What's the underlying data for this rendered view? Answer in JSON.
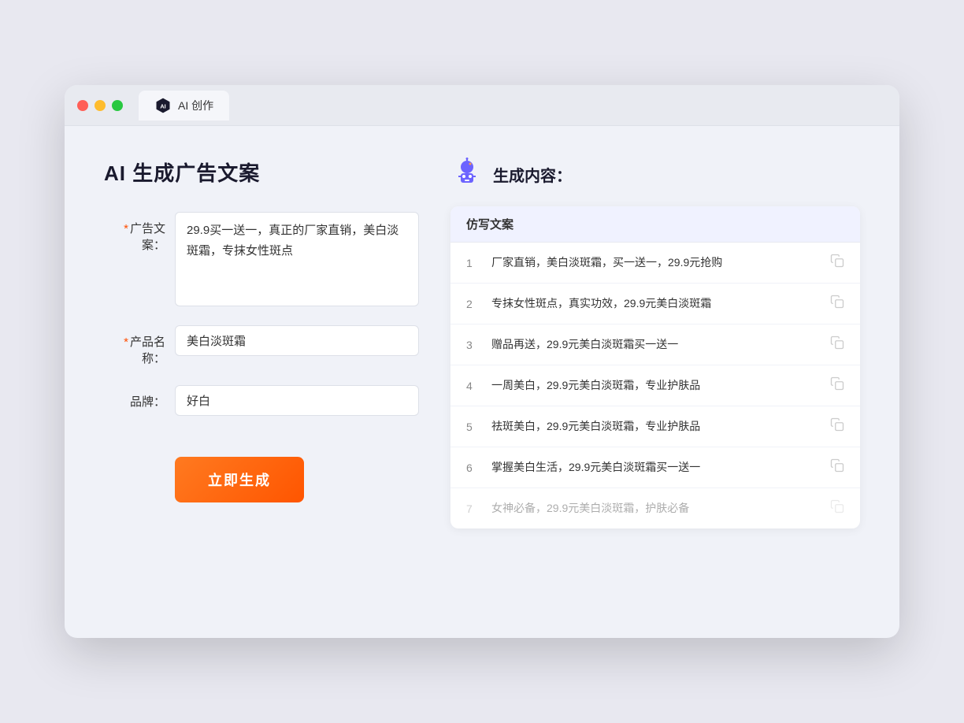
{
  "browser": {
    "tab_label": "AI 创作"
  },
  "page": {
    "title": "AI 生成广告文案",
    "form": {
      "ad_copy_label": "广告文案：",
      "ad_copy_required": "*",
      "ad_copy_value": "29.9买一送一，真正的厂家直销，美白淡斑霜，专抹女性斑点",
      "product_name_label": "产品名称：",
      "product_name_required": "*",
      "product_name_value": "美白淡斑霜",
      "brand_label": "品牌：",
      "brand_value": "好白",
      "generate_button_label": "立即生成"
    },
    "results": {
      "header_label": "生成内容：",
      "column_label": "仿写文案",
      "items": [
        {
          "num": "1",
          "text": "厂家直销，美白淡斑霜，买一送一，29.9元抢购",
          "faded": false
        },
        {
          "num": "2",
          "text": "专抹女性斑点，真实功效，29.9元美白淡斑霜",
          "faded": false
        },
        {
          "num": "3",
          "text": "赠品再送，29.9元美白淡斑霜买一送一",
          "faded": false
        },
        {
          "num": "4",
          "text": "一周美白，29.9元美白淡斑霜，专业护肤品",
          "faded": false
        },
        {
          "num": "5",
          "text": "祛斑美白，29.9元美白淡斑霜，专业护肤品",
          "faded": false
        },
        {
          "num": "6",
          "text": "掌握美白生活，29.9元美白淡斑霜买一送一",
          "faded": false
        },
        {
          "num": "7",
          "text": "女神必备，29.9元美白淡斑霜，护肤必备",
          "faded": true
        }
      ]
    }
  },
  "icons": {
    "robot": "🤖",
    "copy": "📋",
    "ai_badge": "AI"
  }
}
